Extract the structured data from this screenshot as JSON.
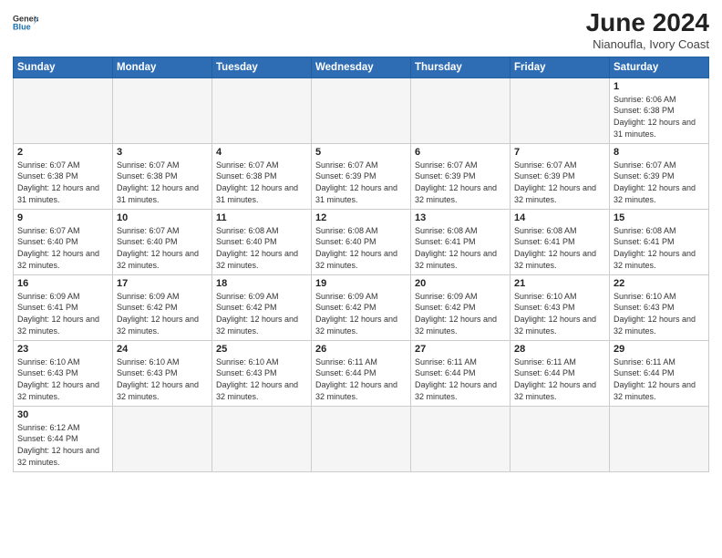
{
  "logo": {
    "line1": "General",
    "line2": "Blue"
  },
  "title": "June 2024",
  "subtitle": "Nianoufla, Ivory Coast",
  "days_of_week": [
    "Sunday",
    "Monday",
    "Tuesday",
    "Wednesday",
    "Thursday",
    "Friday",
    "Saturday"
  ],
  "weeks": [
    [
      {
        "day": "",
        "info": ""
      },
      {
        "day": "",
        "info": ""
      },
      {
        "day": "",
        "info": ""
      },
      {
        "day": "",
        "info": ""
      },
      {
        "day": "",
        "info": ""
      },
      {
        "day": "",
        "info": ""
      },
      {
        "day": "1",
        "info": "Sunrise: 6:06 AM\nSunset: 6:38 PM\nDaylight: 12 hours and 31 minutes."
      }
    ],
    [
      {
        "day": "2",
        "info": "Sunrise: 6:07 AM\nSunset: 6:38 PM\nDaylight: 12 hours and 31 minutes."
      },
      {
        "day": "3",
        "info": "Sunrise: 6:07 AM\nSunset: 6:38 PM\nDaylight: 12 hours and 31 minutes."
      },
      {
        "day": "4",
        "info": "Sunrise: 6:07 AM\nSunset: 6:38 PM\nDaylight: 12 hours and 31 minutes."
      },
      {
        "day": "5",
        "info": "Sunrise: 6:07 AM\nSunset: 6:39 PM\nDaylight: 12 hours and 31 minutes."
      },
      {
        "day": "6",
        "info": "Sunrise: 6:07 AM\nSunset: 6:39 PM\nDaylight: 12 hours and 32 minutes."
      },
      {
        "day": "7",
        "info": "Sunrise: 6:07 AM\nSunset: 6:39 PM\nDaylight: 12 hours and 32 minutes."
      },
      {
        "day": "8",
        "info": "Sunrise: 6:07 AM\nSunset: 6:39 PM\nDaylight: 12 hours and 32 minutes."
      }
    ],
    [
      {
        "day": "9",
        "info": "Sunrise: 6:07 AM\nSunset: 6:40 PM\nDaylight: 12 hours and 32 minutes."
      },
      {
        "day": "10",
        "info": "Sunrise: 6:07 AM\nSunset: 6:40 PM\nDaylight: 12 hours and 32 minutes."
      },
      {
        "day": "11",
        "info": "Sunrise: 6:08 AM\nSunset: 6:40 PM\nDaylight: 12 hours and 32 minutes."
      },
      {
        "day": "12",
        "info": "Sunrise: 6:08 AM\nSunset: 6:40 PM\nDaylight: 12 hours and 32 minutes."
      },
      {
        "day": "13",
        "info": "Sunrise: 6:08 AM\nSunset: 6:41 PM\nDaylight: 12 hours and 32 minutes."
      },
      {
        "day": "14",
        "info": "Sunrise: 6:08 AM\nSunset: 6:41 PM\nDaylight: 12 hours and 32 minutes."
      },
      {
        "day": "15",
        "info": "Sunrise: 6:08 AM\nSunset: 6:41 PM\nDaylight: 12 hours and 32 minutes."
      }
    ],
    [
      {
        "day": "16",
        "info": "Sunrise: 6:09 AM\nSunset: 6:41 PM\nDaylight: 12 hours and 32 minutes."
      },
      {
        "day": "17",
        "info": "Sunrise: 6:09 AM\nSunset: 6:42 PM\nDaylight: 12 hours and 32 minutes."
      },
      {
        "day": "18",
        "info": "Sunrise: 6:09 AM\nSunset: 6:42 PM\nDaylight: 12 hours and 32 minutes."
      },
      {
        "day": "19",
        "info": "Sunrise: 6:09 AM\nSunset: 6:42 PM\nDaylight: 12 hours and 32 minutes."
      },
      {
        "day": "20",
        "info": "Sunrise: 6:09 AM\nSunset: 6:42 PM\nDaylight: 12 hours and 32 minutes."
      },
      {
        "day": "21",
        "info": "Sunrise: 6:10 AM\nSunset: 6:43 PM\nDaylight: 12 hours and 32 minutes."
      },
      {
        "day": "22",
        "info": "Sunrise: 6:10 AM\nSunset: 6:43 PM\nDaylight: 12 hours and 32 minutes."
      }
    ],
    [
      {
        "day": "23",
        "info": "Sunrise: 6:10 AM\nSunset: 6:43 PM\nDaylight: 12 hours and 32 minutes."
      },
      {
        "day": "24",
        "info": "Sunrise: 6:10 AM\nSunset: 6:43 PM\nDaylight: 12 hours and 32 minutes."
      },
      {
        "day": "25",
        "info": "Sunrise: 6:10 AM\nSunset: 6:43 PM\nDaylight: 12 hours and 32 minutes."
      },
      {
        "day": "26",
        "info": "Sunrise: 6:11 AM\nSunset: 6:44 PM\nDaylight: 12 hours and 32 minutes."
      },
      {
        "day": "27",
        "info": "Sunrise: 6:11 AM\nSunset: 6:44 PM\nDaylight: 12 hours and 32 minutes."
      },
      {
        "day": "28",
        "info": "Sunrise: 6:11 AM\nSunset: 6:44 PM\nDaylight: 12 hours and 32 minutes."
      },
      {
        "day": "29",
        "info": "Sunrise: 6:11 AM\nSunset: 6:44 PM\nDaylight: 12 hours and 32 minutes."
      }
    ],
    [
      {
        "day": "30",
        "info": "Sunrise: 6:12 AM\nSunset: 6:44 PM\nDaylight: 12 hours and 32 minutes."
      },
      {
        "day": "",
        "info": ""
      },
      {
        "day": "",
        "info": ""
      },
      {
        "day": "",
        "info": ""
      },
      {
        "day": "",
        "info": ""
      },
      {
        "day": "",
        "info": ""
      },
      {
        "day": "",
        "info": ""
      }
    ]
  ],
  "colors": {
    "header_bg": "#2e6db4",
    "accent_blue": "#1a6faf"
  }
}
